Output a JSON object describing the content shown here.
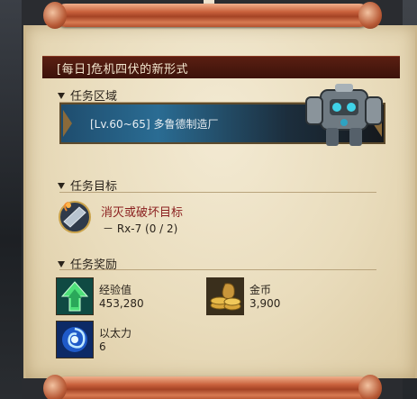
{
  "quest": {
    "title": "[每日]危机四伏的新形式"
  },
  "sections": {
    "area_label": "任务区域",
    "objective_label": "任务目标",
    "reward_label": "任务奖励"
  },
  "area": {
    "text": "[Lv.60~65] 多鲁德制造厂"
  },
  "objective": {
    "name": "消灭或破坏目标",
    "progress": "－ Rx-7 (0 / 2)"
  },
  "rewards": [
    {
      "name": "经验值",
      "value": "453,280",
      "icon": "exp-arrow-icon"
    },
    {
      "name": "金币",
      "value": "3,900",
      "icon": "gold-coins-icon"
    },
    {
      "name": "以太力",
      "value": "6",
      "icon": "ether-swirl-icon"
    }
  ],
  "colors": {
    "title_bar": "#4a180e",
    "objective_name": "#8a1e1e",
    "parchment": "#ebdfc3"
  }
}
